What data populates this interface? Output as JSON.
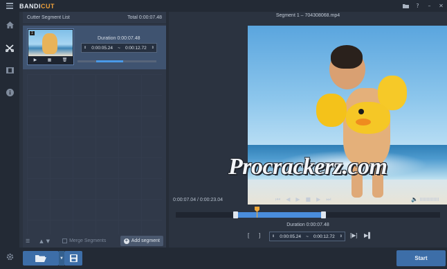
{
  "app": {
    "logo_main": "BANDI",
    "logo_accent": "CUT"
  },
  "window_controls": [
    "folder-icon",
    "help-icon",
    "minimize-icon",
    "close-icon"
  ],
  "sidebar": {
    "items": [
      {
        "name": "home",
        "icon": "home-icon"
      },
      {
        "name": "cutter",
        "icon": "cut-icon",
        "active": true
      },
      {
        "name": "joiner",
        "icon": "film-icon"
      },
      {
        "name": "info",
        "icon": "info-icon"
      },
      {
        "name": "settings",
        "icon": "gear-icon"
      }
    ]
  },
  "list_panel": {
    "title": "Cutter Segment List",
    "total": "Total 0:00:07.48",
    "segments": [
      {
        "number": "1",
        "duration": "Duration 0:00:07.48",
        "start": "0:00:05.24",
        "separator": "~",
        "end": "0:00:12.72",
        "progress_start": 0.24,
        "progress_end": 0.58
      }
    ],
    "footer": {
      "merge_label": "Merge Segments",
      "merge_checked": false,
      "add_label": "Add segment"
    }
  },
  "preview": {
    "title": "Segment 1 – 704308068.mp4",
    "watermark": "Procrackerz.com",
    "time_display": "0:00:07.04 / 0:00:23.04",
    "volume": 0.9,
    "timeline": {
      "segment_start": "0:00:05.24",
      "segment_end": "0:00:12.72",
      "current": "0:00:07.04",
      "total": "0:00:23.04"
    },
    "duration": "Duration 0:00:07.48",
    "start": "0:00:05.24",
    "separator": "~",
    "end": "0:00:12.72"
  },
  "bottom": {
    "start_label": "Start"
  },
  "colors": {
    "accent": "#3d6ea8",
    "timeline_range": "#4a8ddc",
    "playhead": "#f0a838",
    "logo_accent": "#f2a33c"
  }
}
